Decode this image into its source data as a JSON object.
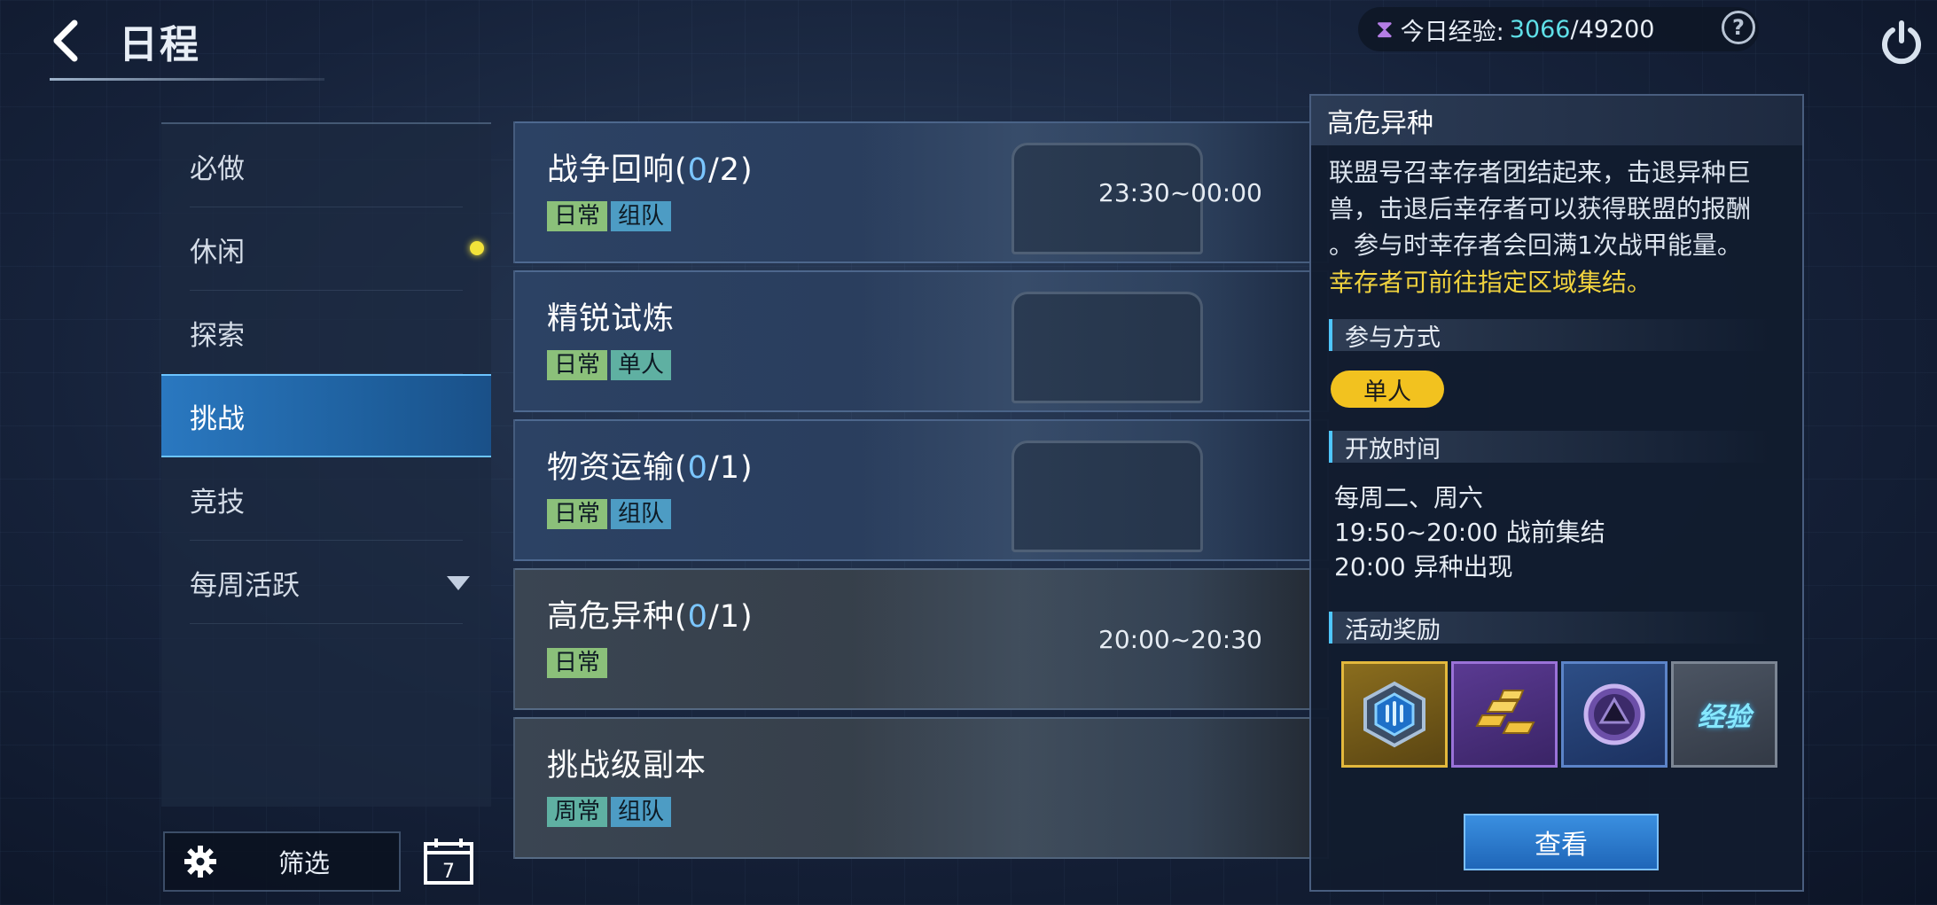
{
  "header": {
    "title": "日程",
    "exp_label": "今日经验:",
    "exp_current": "3066",
    "exp_separator": "/",
    "exp_max": "49200",
    "help": "?"
  },
  "sidebar": {
    "items": [
      {
        "label": "必做"
      },
      {
        "label": "休闲"
      },
      {
        "label": "探索"
      },
      {
        "label": "挑战"
      },
      {
        "label": "竞技"
      },
      {
        "label": "每周活跃"
      }
    ],
    "active_index": 3,
    "filter_label": "筛选",
    "calendar_day": "7"
  },
  "cards": [
    {
      "name": "战争回响",
      "progress_open": "(",
      "progress_value": "0",
      "progress_rest": "/2)",
      "tags": [
        "日常",
        "组队"
      ],
      "time": "23:30~00:00"
    },
    {
      "name": "精锐试炼",
      "tags": [
        "日常",
        "单人"
      ],
      "time": ""
    },
    {
      "name": "物资运输",
      "progress_open": "(",
      "progress_value": "0",
      "progress_rest": "/1)",
      "tags": [
        "日常",
        "组队"
      ],
      "time": ""
    },
    {
      "name": "高危异种",
      "progress_open": "(",
      "progress_value": "0",
      "progress_rest": "/1)",
      "tags": [
        "日常"
      ],
      "time": "20:00~20:30"
    },
    {
      "name": "挑战级副本",
      "tags": [
        "周常",
        "组队"
      ],
      "time": ""
    }
  ],
  "detail": {
    "title": "高危异种",
    "description_lines": [
      "联盟号召幸存者团结起来，击退异种巨",
      "兽，击退后幸存者可以获得联盟的报酬",
      "。参与时幸存者会回满1次战甲能量。"
    ],
    "highlight": "幸存者可前往指定区域集结。",
    "mode_section": "参与方式",
    "mode": "单人",
    "time_section": "开放时间",
    "time_lines": [
      "每周二、周六",
      "19:50~20:00 战前集结",
      "20:00 异种出现"
    ],
    "reward_section": "活动奖励",
    "rewards": [
      {
        "icon": "armor-core-icon",
        "rarity": "gold"
      },
      {
        "icon": "gold-bars-icon",
        "rarity": "purple"
      },
      {
        "icon": "crystal-token-icon",
        "rarity": "blue"
      },
      {
        "icon": "exp-icon",
        "rarity": "gray",
        "text": "经验"
      }
    ],
    "view_button": "查看"
  },
  "colors": {
    "accent_blue": "#2a78c0",
    "progress_blue": "#7bc6ff",
    "highlight_yellow": "#f0d23e",
    "exp_cyan": "#5fe0e8",
    "tag_green": "#8bc07a",
    "tag_blue": "#4d9cc4"
  }
}
